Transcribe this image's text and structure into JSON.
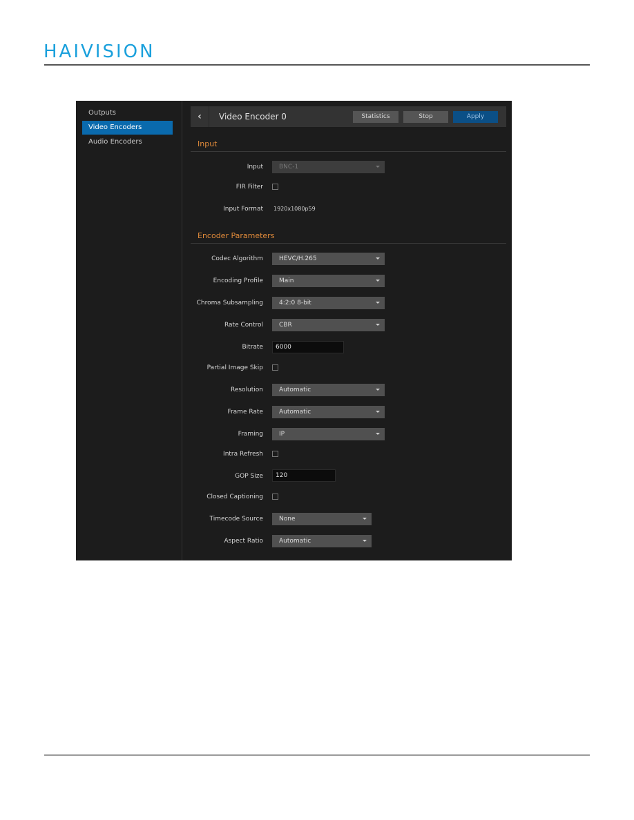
{
  "brand": {
    "logo_text": "HAIVISION",
    "color": "#1aa0dc"
  },
  "sidebar": {
    "items": [
      {
        "label": "Outputs",
        "active": false
      },
      {
        "label": "Video Encoders",
        "active": true
      },
      {
        "label": "Audio Encoders",
        "active": false
      }
    ]
  },
  "header": {
    "back_icon": "chevron-left",
    "title": "Video Encoder 0",
    "buttons": {
      "statistics": "Statistics",
      "stop": "Stop",
      "apply": "Apply"
    }
  },
  "sections": {
    "input": {
      "title": "Input",
      "input_label": "Input",
      "input_value": "BNC-1",
      "fir_filter_label": "FIR Filter",
      "fir_filter_checked": false,
      "input_format_label": "Input Format",
      "input_format_value": "1920x1080p59"
    },
    "encoder": {
      "title": "Encoder Parameters",
      "codec_label": "Codec Algorithm",
      "codec_value": "HEVC/H.265",
      "profile_label": "Encoding Profile",
      "profile_value": "Main",
      "chroma_label": "Chroma Subsampling",
      "chroma_value": "4:2:0 8-bit",
      "rate_label": "Rate Control",
      "rate_value": "CBR",
      "bitrate_label": "Bitrate",
      "bitrate_value": "6000",
      "pis_label": "Partial Image Skip",
      "pis_checked": false,
      "resolution_label": "Resolution",
      "resolution_value": "Automatic",
      "framerate_label": "Frame Rate",
      "framerate_value": "Automatic",
      "framing_label": "Framing",
      "framing_value": "IP",
      "intra_label": "Intra Refresh",
      "intra_checked": false,
      "gop_label": "GOP Size",
      "gop_value": "120",
      "cc_label": "Closed Captioning",
      "cc_checked": false,
      "timecode_label": "Timecode Source",
      "timecode_value": "None",
      "aspect_label": "Aspect Ratio",
      "aspect_value": "Automatic"
    }
  },
  "colors": {
    "accent_blue": "#0a6aad",
    "apply_blue": "#0b4f86",
    "section_orange": "#e08a3a",
    "panel_bg": "#1c1c1c"
  }
}
